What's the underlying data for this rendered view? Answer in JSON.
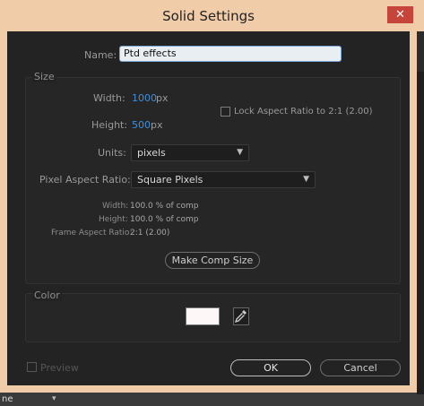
{
  "window": {
    "title": "Solid Settings",
    "close_icon": "close-icon"
  },
  "name": {
    "label": "Name:",
    "value": "Ptd effects"
  },
  "size": {
    "group_label": "Size",
    "width_label": "Width:",
    "width_value": "1000",
    "width_unit": "px",
    "height_label": "Height:",
    "height_value": "500",
    "height_unit": "px",
    "lock_label": "Lock Aspect Ratio to 2:1 (2.00)",
    "units_label": "Units:",
    "units_value": "pixels",
    "par_label": "Pixel Aspect Ratio:",
    "par_value": "Square Pixels",
    "info_width_label": "Width:",
    "info_width_value": "100.0 % of comp",
    "info_height_label": "Height:",
    "info_height_value": "100.0 % of comp",
    "info_far_label": "Frame Aspect Ratio:",
    "info_far_value": "2:1 (2.00)",
    "make_comp_size": "Make Comp Size"
  },
  "color": {
    "group_label": "Color",
    "swatch_hex": "#fdf7f7"
  },
  "footer": {
    "preview_label": "Preview",
    "ok_label": "OK",
    "cancel_label": "Cancel"
  },
  "background": {
    "footer_text": "ne"
  }
}
